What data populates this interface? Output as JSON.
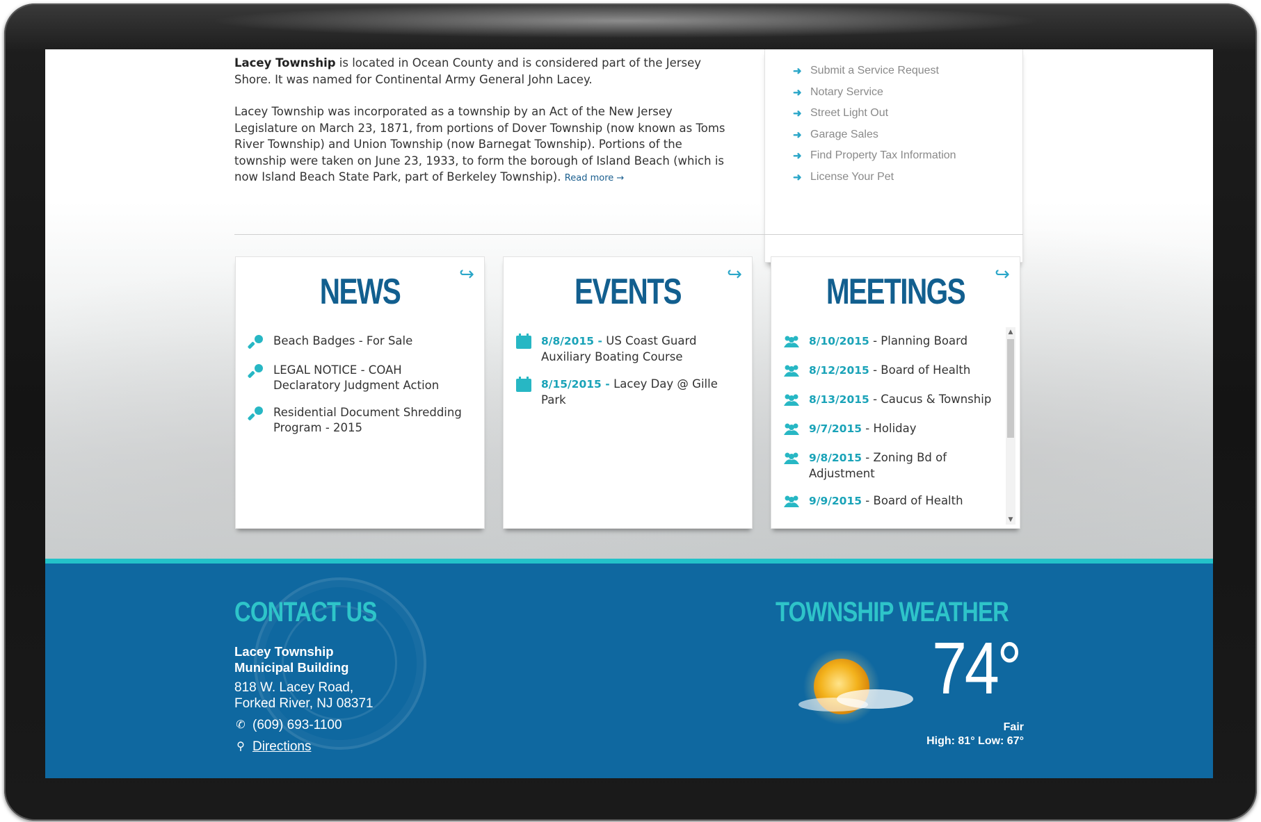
{
  "intro": {
    "p1_bold": "Lacey Township",
    "p1_rest": " is located in Ocean County and is considered part of the Jersey Shore. It was named for Continental Army General John Lacey.",
    "p2": "Lacey Township was incorporated as a township by an Act of the New Jersey Legislature on March 23, 1871, from portions of Dover Township (now known as Toms River Township) and Union Township (now Barnegat Township). Portions of the township were taken on June 23, 1933, to form the borough of Island Beach (which is now Island Beach State Park, part of Berkeley Township).",
    "read_more": "Read more →"
  },
  "services": {
    "items": [
      {
        "label": "Submit a Service Request"
      },
      {
        "label": "Notary Service"
      },
      {
        "label": "Street Light Out"
      },
      {
        "label": "Garage Sales"
      },
      {
        "label": "Find Property Tax Information"
      },
      {
        "label": "License Your Pet"
      }
    ]
  },
  "news": {
    "title": "NEWS",
    "items": [
      {
        "text": "Beach Badges - For Sale"
      },
      {
        "text": "LEGAL NOTICE - COAH Declaratory Judgment Action"
      },
      {
        "text": "Residential Document Shredding Program - 2015"
      }
    ]
  },
  "events": {
    "title": "EVENTS",
    "items": [
      {
        "date": "8/8/2015",
        "text": "US Coast Guard Auxiliary Boating Course"
      },
      {
        "date": "8/15/2015",
        "text": "Lacey Day @ Gille Park"
      }
    ]
  },
  "meetings": {
    "title": "MEETINGS",
    "items": [
      {
        "date": "8/10/2015",
        "text": "Planning Board"
      },
      {
        "date": "8/12/2015",
        "text": "Board of Health"
      },
      {
        "date": "8/13/2015",
        "text": "Caucus & Township"
      },
      {
        "date": "9/7/2015",
        "text": "Holiday"
      },
      {
        "date": "9/8/2015",
        "text": "Zoning Bd of Adjustment"
      },
      {
        "date": "9/9/2015",
        "text": "Board of Health"
      }
    ]
  },
  "contact": {
    "title": "CONTACT US",
    "org_line1": "Lacey Township",
    "org_line2": "Municipal Building",
    "address1": "818 W. Lacey Road,",
    "address2": "Forked River, NJ 08371",
    "phone": "(609) 693-1100",
    "directions": "Directions"
  },
  "weather": {
    "title": "TOWNSHIP WEATHER",
    "temp": "74°",
    "condition": "Fair",
    "high_low": "High: 81° Low: 67°"
  },
  "colors": {
    "brand_blue": "#125f8f",
    "accent_teal": "#27b7c4",
    "footer_blue": "#0f68a0"
  }
}
